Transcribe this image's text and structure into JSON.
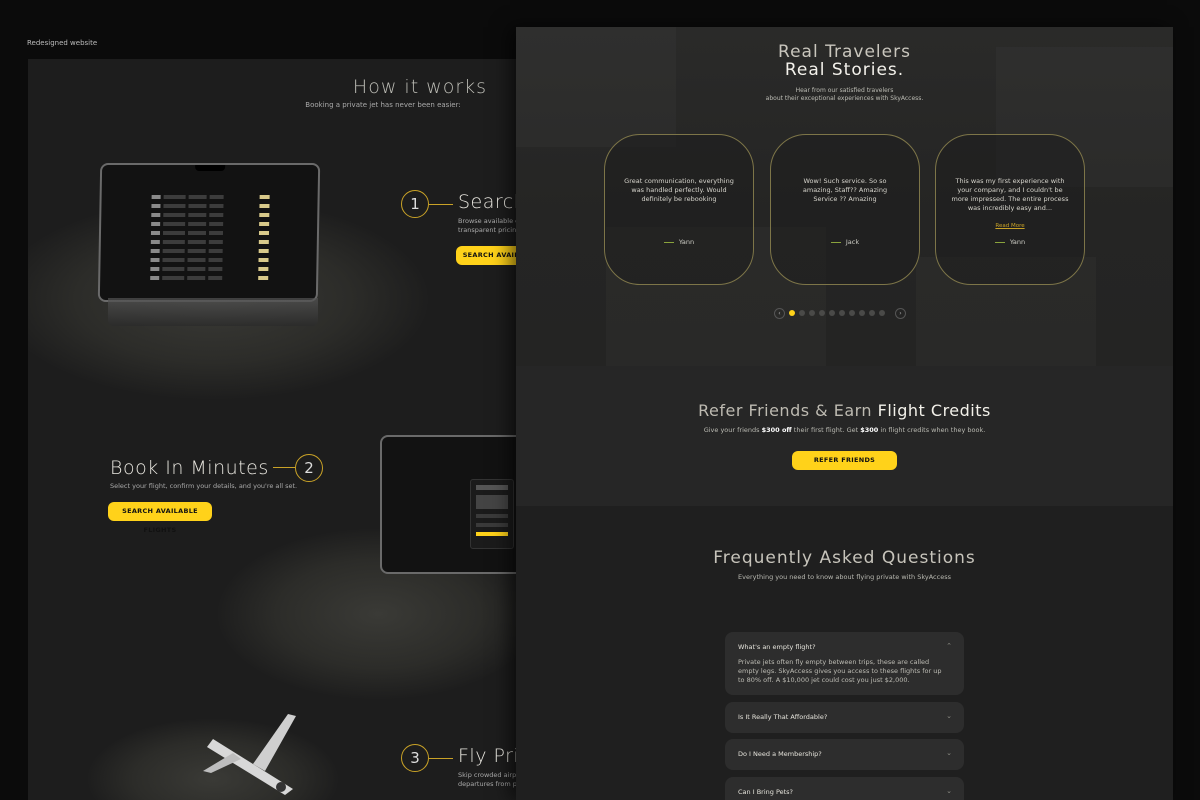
{
  "caption": "Redesigned website",
  "how": {
    "title": "How it works",
    "subtitle": "Booking a private jet has never been easier:",
    "steps": [
      {
        "num": "1",
        "title": "Search",
        "desc1": "Browse available em",
        "desc2": "transparent pricing",
        "button": "SEARCH AVAILAB"
      },
      {
        "num": "2",
        "title": "Book In Minutes",
        "desc1": "Select your flight, confirm your details, and you're all set.",
        "button": "SEARCH AVAILABLE FLIGHTS"
      },
      {
        "num": "3",
        "title": "Fly Pri",
        "desc1": "Skip crowded airpo",
        "desc2": "departures from pr"
      }
    ]
  },
  "stories": {
    "title_line1": "Real Travelers",
    "title_line2": "Real Stories.",
    "sub_line1": "Hear from our satisfied travelers",
    "sub_line2": "about their exceptional experiences with SkyAccess.",
    "cards": [
      {
        "quote": "Great communication, everything was handled perfectly. Would definitely be rebooking",
        "author": "Yann"
      },
      {
        "quote": "Wow! Such service. So so amazing, Staff?? Amazing Service ?? Amazing",
        "author": "Jack"
      },
      {
        "quote": "This was my first experience with your company, and I couldn't be more impressed. The entire process was incredibly easy and...",
        "read_more": "Read More",
        "author": "Yann"
      }
    ],
    "prev_icon": "‹",
    "next_icon": "›"
  },
  "refer": {
    "title_plain": "Refer Friends & Earn ",
    "title_bold": "Flight Credits",
    "desc_a": "Give your friends ",
    "desc_b": "$300 off",
    "desc_c": " their first flight. Get ",
    "desc_d": "$300",
    "desc_e": " in flight credits when they book.",
    "button": "REFER FRIENDS"
  },
  "faq": {
    "title": "Frequently Asked Questions",
    "subtitle": "Everything you need to know about flying private with SkyAccess",
    "items": [
      {
        "q": "What's an empty flight?",
        "a": "Private jets often fly empty between trips, these are called empty legs. SkyAccess gives you access to these flights for up to 80% off. A $10,000 jet could cost you just $2,000.",
        "chev": "⌃"
      },
      {
        "q": "Is It Really That Affordable?",
        "chev": "⌄"
      },
      {
        "q": "Do I Need a Membership?",
        "chev": "⌄"
      },
      {
        "q": "Can I Bring Pets?",
        "chev": "⌄"
      }
    ]
  },
  "colors": {
    "accent": "#ffd21a",
    "gold_line": "#c9a227",
    "bg": "#1d1d1d"
  }
}
